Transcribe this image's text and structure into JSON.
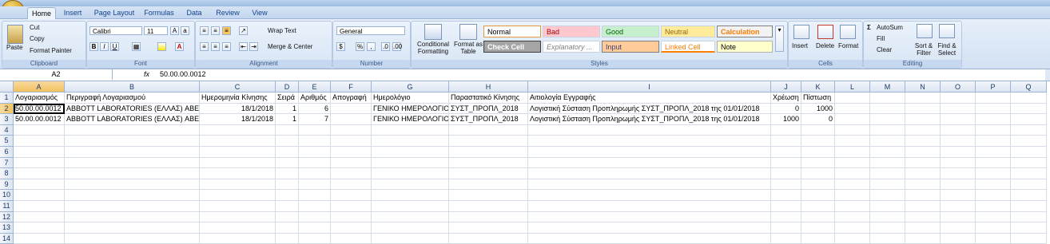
{
  "ribbon": {
    "tabs": [
      "Home",
      "Insert",
      "Page Layout",
      "Formulas",
      "Data",
      "Review",
      "View"
    ],
    "active_tab": "Home",
    "clipboard": {
      "paste": "Paste",
      "cut": "Cut",
      "copy": "Copy",
      "format_painter": "Format Painter",
      "group": "Clipboard"
    },
    "font": {
      "name": "Calibri",
      "size": "11",
      "group": "Font",
      "bold": "B",
      "italic": "I",
      "underline": "U"
    },
    "alignment": {
      "wrap_text": "Wrap Text",
      "merge_center": "Merge & Center",
      "group": "Alignment"
    },
    "number": {
      "format": "General",
      "percent": "%",
      "comma": ",",
      "group": "Number"
    },
    "styles": {
      "conditional": "Conditional Formatting",
      "format_table": "Format as Table",
      "cell_styles": [
        "Normal",
        "Bad",
        "Good",
        "Neutral",
        "Calculation",
        "Check Cell",
        "Explanatory ...",
        "Input",
        "Linked Cell",
        "Note"
      ],
      "group": "Styles"
    },
    "cells": {
      "insert": "Insert",
      "delete": "Delete",
      "format": "Format",
      "group": "Cells"
    },
    "editing": {
      "autosum": "AutoSum",
      "fill": "Fill",
      "clear": "Clear",
      "sort_filter": "Sort & Filter",
      "find_select": "Find & Select",
      "group": "Editing"
    }
  },
  "formula_bar": {
    "name_box": "A2",
    "fx": "fx",
    "value": "50.00.00.0012"
  },
  "sheet": {
    "columns": [
      "A",
      "B",
      "C",
      "D",
      "E",
      "F",
      "G",
      "H",
      "I",
      "J",
      "K",
      "L",
      "M",
      "N",
      "O",
      "P",
      "Q"
    ],
    "row_numbers": [
      "1",
      "2",
      "3",
      "4",
      "5",
      "6",
      "7",
      "8",
      "9",
      "10",
      "11",
      "12",
      "13",
      "14"
    ],
    "header_row": [
      "Λογαριασμός",
      "Περιγραφή Λογαριασμού",
      "Ημερομηνία Κίνησης",
      "Σειρά",
      "Αριθμός",
      "Απογραφή",
      "Ημερολόγιο",
      "Παραστατικό Κίνησης",
      "Αιτιολογία Εγγραφής",
      "Χρέωση",
      "Πίστωση"
    ],
    "rows": [
      [
        "50.00.00.0012",
        "ABBOTT LABORATORIES (ΕΛΛΑΣ) ΑΒΕΕ",
        "18/1/2018",
        "1",
        "6",
        "",
        "ΓΕΝΙΚΟ ΗΜΕΡΟΛΟΓΙΟ",
        "ΣΥΣΤ_ΠΡΟΠΛ_2018",
        "Λογιστική Σύσταση Προπληρωμής ΣΥΣΤ_ΠΡΟΠΛ_2018 της 01/01/2018",
        "0",
        "1000"
      ],
      [
        "50.00.00.0012",
        "ABBOTT LABORATORIES (ΕΛΛΑΣ) ΑΒΕΕ",
        "18/1/2018",
        "1",
        "7",
        "",
        "ΓΕΝΙΚΟ ΗΜΕΡΟΛΟΓΙΟ",
        "ΣΥΣΤ_ΠΡΟΠΛ_2018",
        "Λογιστική Σύσταση Προπληρωμής ΣΥΣΤ_ΠΡΟΠΛ_2018 της 01/01/2018",
        "1000",
        "0"
      ]
    ]
  },
  "colors": {
    "accent": "#15428b",
    "selected_header": "#f1c15f"
  }
}
